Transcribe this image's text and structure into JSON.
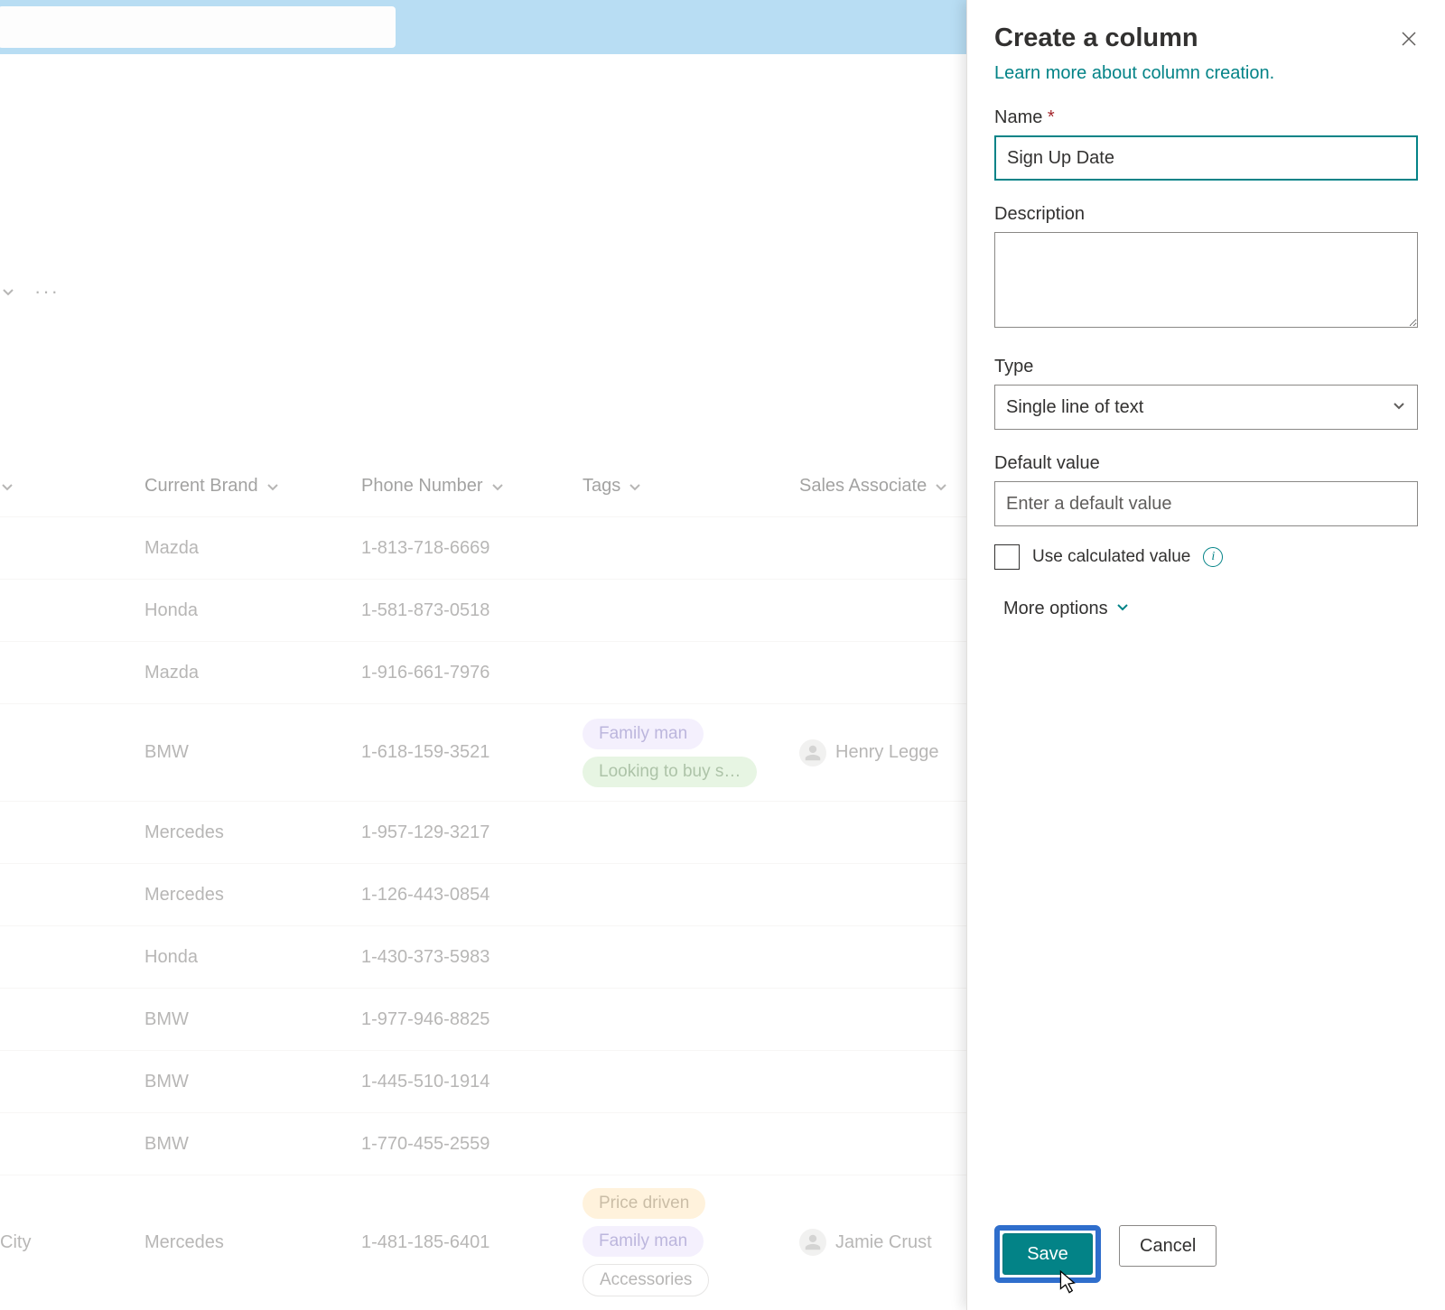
{
  "topbar": {
    "search_value": ""
  },
  "table": {
    "columns": {
      "col0_partial": "City",
      "brand": "Current Brand",
      "phone": "Phone Number",
      "tags": "Tags",
      "associate": "Sales Associate"
    },
    "rows": [
      {
        "c0": "",
        "brand": "Mazda",
        "phone": "1-813-718-6669",
        "tags": [],
        "associate": ""
      },
      {
        "c0": "",
        "brand": "Honda",
        "phone": "1-581-873-0518",
        "tags": [],
        "associate": ""
      },
      {
        "c0": "",
        "brand": "Mazda",
        "phone": "1-916-661-7976",
        "tags": [],
        "associate": ""
      },
      {
        "c0": "",
        "brand": "BMW",
        "phone": "1-618-159-3521",
        "tags": [
          {
            "text": "Family man",
            "cls": "tag-purple"
          },
          {
            "text": "Looking to buy s…",
            "cls": "tag-green"
          }
        ],
        "associate": "Henry Legge"
      },
      {
        "c0": "",
        "brand": "Mercedes",
        "phone": "1-957-129-3217",
        "tags": [],
        "associate": ""
      },
      {
        "c0": "",
        "brand": "Mercedes",
        "phone": "1-126-443-0854",
        "tags": [],
        "associate": ""
      },
      {
        "c0": "",
        "brand": "Honda",
        "phone": "1-430-373-5983",
        "tags": [],
        "associate": ""
      },
      {
        "c0": "",
        "brand": "BMW",
        "phone": "1-977-946-8825",
        "tags": [],
        "associate": ""
      },
      {
        "c0": "",
        "brand": "BMW",
        "phone": "1-445-510-1914",
        "tags": [],
        "associate": ""
      },
      {
        "c0": "",
        "brand": "BMW",
        "phone": "1-770-455-2559",
        "tags": [],
        "associate": ""
      },
      {
        "c0": "City",
        "brand": "Mercedes",
        "phone": "1-481-185-6401",
        "tags": [
          {
            "text": "Price driven",
            "cls": "tag-yellow"
          },
          {
            "text": "Family man",
            "cls": "tag-purple"
          },
          {
            "text": "Accessories",
            "cls": "tag-outline"
          }
        ],
        "associate": "Jamie Crust"
      }
    ]
  },
  "panel": {
    "title": "Create a column",
    "learn_link": "Learn more about column creation.",
    "name_label": "Name",
    "name_value": "Sign Up Date",
    "desc_label": "Description",
    "desc_value": "",
    "type_label": "Type",
    "type_value": "Single line of text",
    "default_label": "Default value",
    "default_placeholder": "Enter a default value",
    "calc_label": "Use calculated value",
    "more_label": "More options",
    "save_label": "Save",
    "cancel_label": "Cancel"
  }
}
